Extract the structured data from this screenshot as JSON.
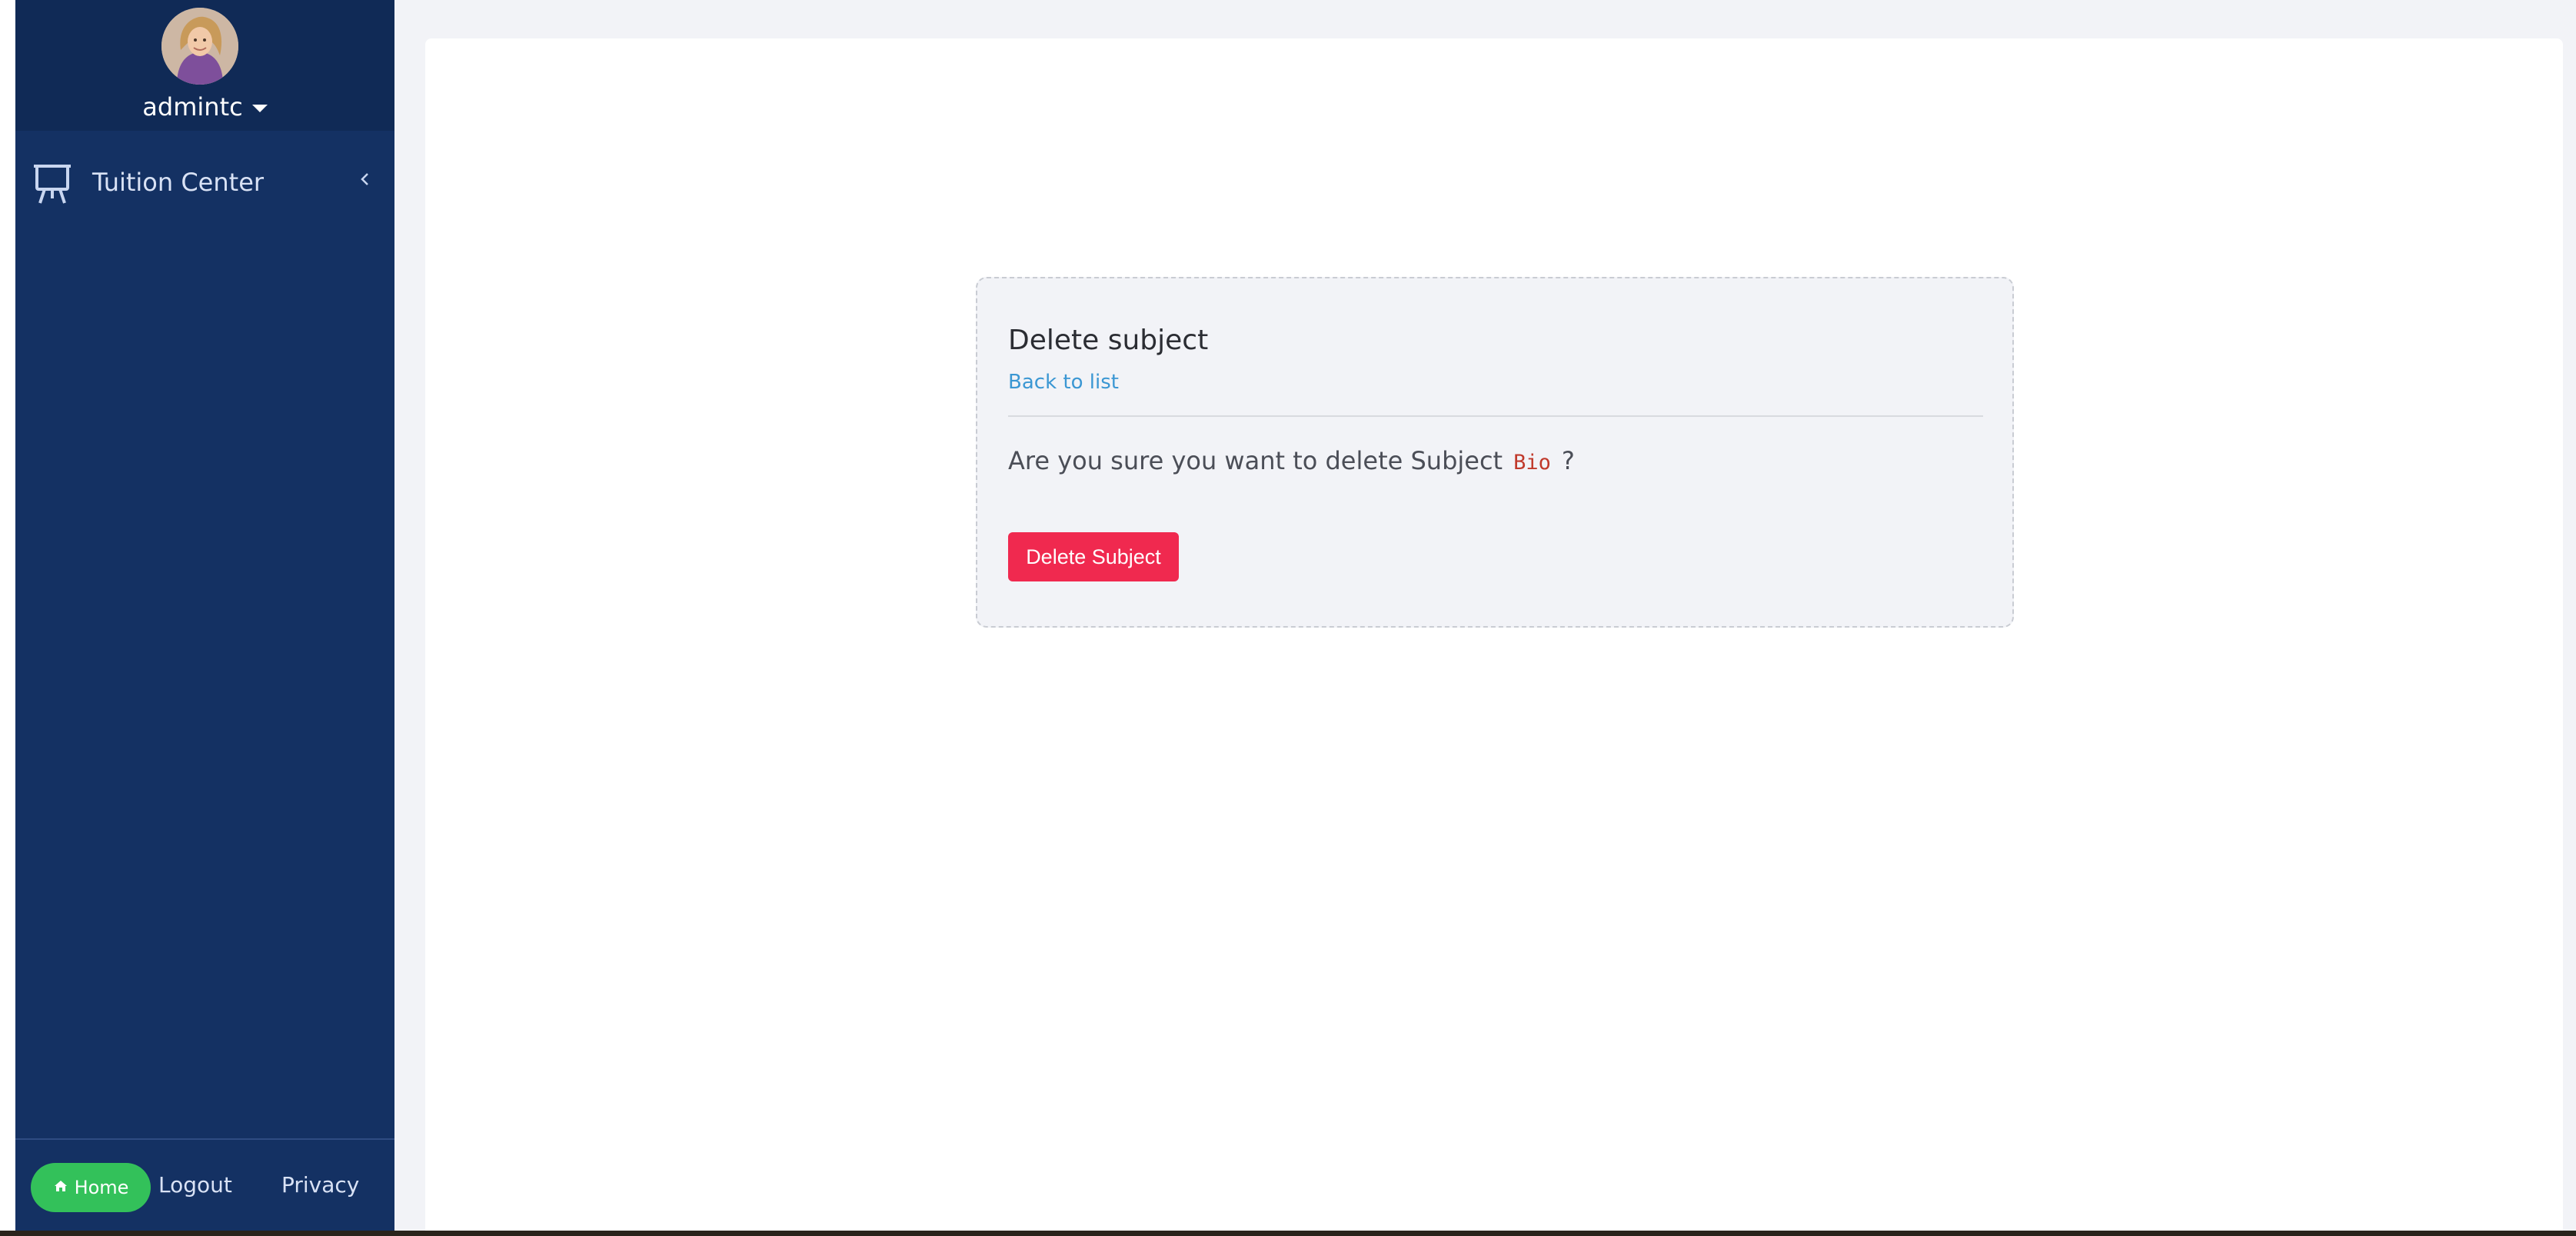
{
  "user": {
    "name": "admintc"
  },
  "sidebar": {
    "items": [
      {
        "label": "Tuition Center",
        "icon": "presentation-board-icon"
      }
    ],
    "footer": {
      "home_label": "Home",
      "logout_label": "Logout",
      "privacy_label": "Privacy"
    }
  },
  "card": {
    "title": "Delete subject",
    "back_link": "Back to list",
    "confirm_prefix": "Are you sure you want to delete Subject",
    "subject_name": "Bio",
    "confirm_suffix": "?",
    "delete_button": "Delete Subject"
  },
  "colors": {
    "sidebar_bg": "#143163",
    "home_button": "#33c15a",
    "delete_button": "#f0294f",
    "link": "#3b97d3",
    "subject_code": "#c0392b"
  }
}
